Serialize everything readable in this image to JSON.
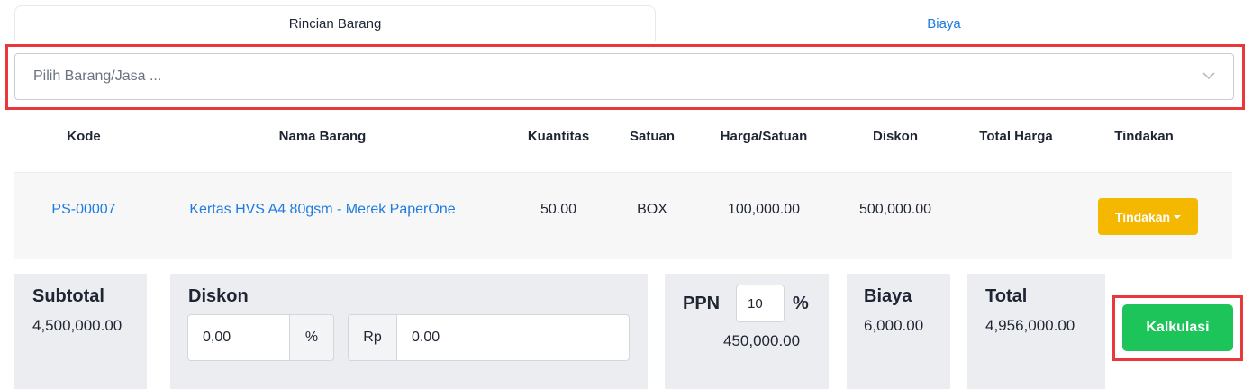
{
  "tabs": [
    {
      "label": "Rincian Barang",
      "active": true
    },
    {
      "label": "Biaya",
      "active": false
    }
  ],
  "item_select": {
    "placeholder": "Pilih Barang/Jasa ...",
    "icon": "chevron-down-icon"
  },
  "table": {
    "headers": [
      "Kode",
      "Nama Barang",
      "Kuantitas",
      "Satuan",
      "Harga/Satuan",
      "Diskon",
      "Total Harga",
      "Tindakan"
    ],
    "rows": [
      {
        "kode": "PS-00007",
        "nama": "Kertas HVS A4 80gsm - Merek PaperOne",
        "kuantitas": "50.00",
        "satuan": "BOX",
        "harga": "100,000.00",
        "diskon": "500,000.00",
        "total": "",
        "action_label": "Tindakan"
      }
    ]
  },
  "summary": {
    "subtotal": {
      "label": "Subtotal",
      "value": "4,500,000.00"
    },
    "diskon": {
      "label": "Diskon",
      "percent_value": "0,00",
      "percent_addon": "%",
      "rp_addon": "Rp",
      "rp_value": "0.00"
    },
    "ppn": {
      "label": "PPN",
      "rate_value": "10",
      "rate_unit": "%",
      "value": "450,000.00"
    },
    "biaya": {
      "label": "Biaya",
      "value": "6,000.00"
    },
    "total": {
      "label": "Total",
      "value": "4,956,000.00"
    }
  },
  "calc_button": {
    "label": "Kalkulasi"
  },
  "colors": {
    "link": "#1e7be0",
    "action": "#f5b800",
    "calc": "#1dc45a",
    "highlight": "#e8383b"
  }
}
